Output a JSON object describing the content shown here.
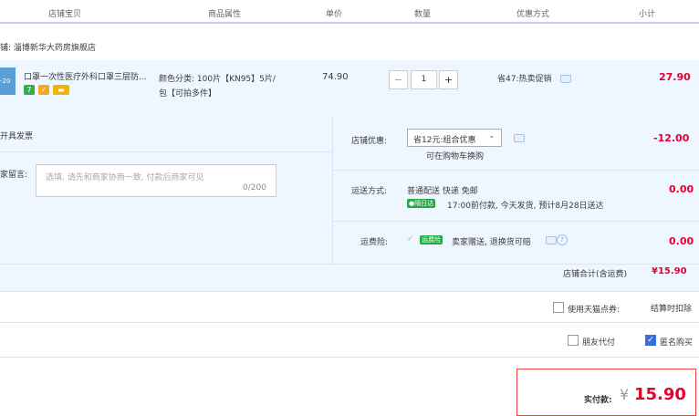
{
  "header": {
    "col_shop": "店铺宝贝",
    "col_attr": "商品属性",
    "col_price": "单价",
    "col_qty": "数量",
    "col_discount": "优惠方式",
    "col_subtotal": "小计"
  },
  "shop": {
    "label": "铺: 淄博新华大药房旗舰店"
  },
  "item": {
    "thumb_text": "-20",
    "title": "口罩一次性医疗外科口罩三层防...",
    "attr_line1": "颜色分类: 100片【KN95】5片/",
    "attr_line2": "包【可拍多件】",
    "price": "74.90",
    "qty_minus": "−",
    "qty": "1",
    "qty_plus": "+",
    "discount": "省47:热卖促销",
    "subtotal": "27.90"
  },
  "options": {
    "invoice": "开具发票",
    "message_label": "家留言:",
    "message_placeholder": "选填, 请先和商家协商一致, 付款后商家可见",
    "message_count": "0/200",
    "shop_discount_label": "店铺优惠:",
    "shop_discount_select": "省12元:组合优惠",
    "shop_discount_hint": "可在购物车换购",
    "shop_discount_value": "-12.00",
    "shipping_label": "运送方式:",
    "shipping_method": "普通配送 快递 免邮",
    "shipping_tag": "●隔日达",
    "shipping_detail": "17:00前付款, 今天发货, 预计8月28日送达",
    "shipping_value": "0.00",
    "insurance_label": "运费险:",
    "insurance_tag": "运费险",
    "insurance_detail": "卖家赠送, 退换货可赔",
    "insurance_value": "0.00",
    "store_total_label": "店铺合计(含运费)",
    "store_total_value": "¥15.90"
  },
  "extras": {
    "tmall_points": "使用天猫点券:",
    "tmall_points_note": "结算时扣除",
    "friend_pay": "朋友代付",
    "anonymous": "匿名购买"
  },
  "pay": {
    "label": "实付款:",
    "currency": "¥",
    "amount": "15.90"
  },
  "colors": {
    "accent_red": "#e5002f",
    "light_blue_bg": "#eef6ff",
    "checkbox_blue": "#3a6fd8"
  },
  "icons": [
    "chat-icon",
    "help-icon",
    "dropdown-chevron-icon",
    "checkbox-icon"
  ]
}
